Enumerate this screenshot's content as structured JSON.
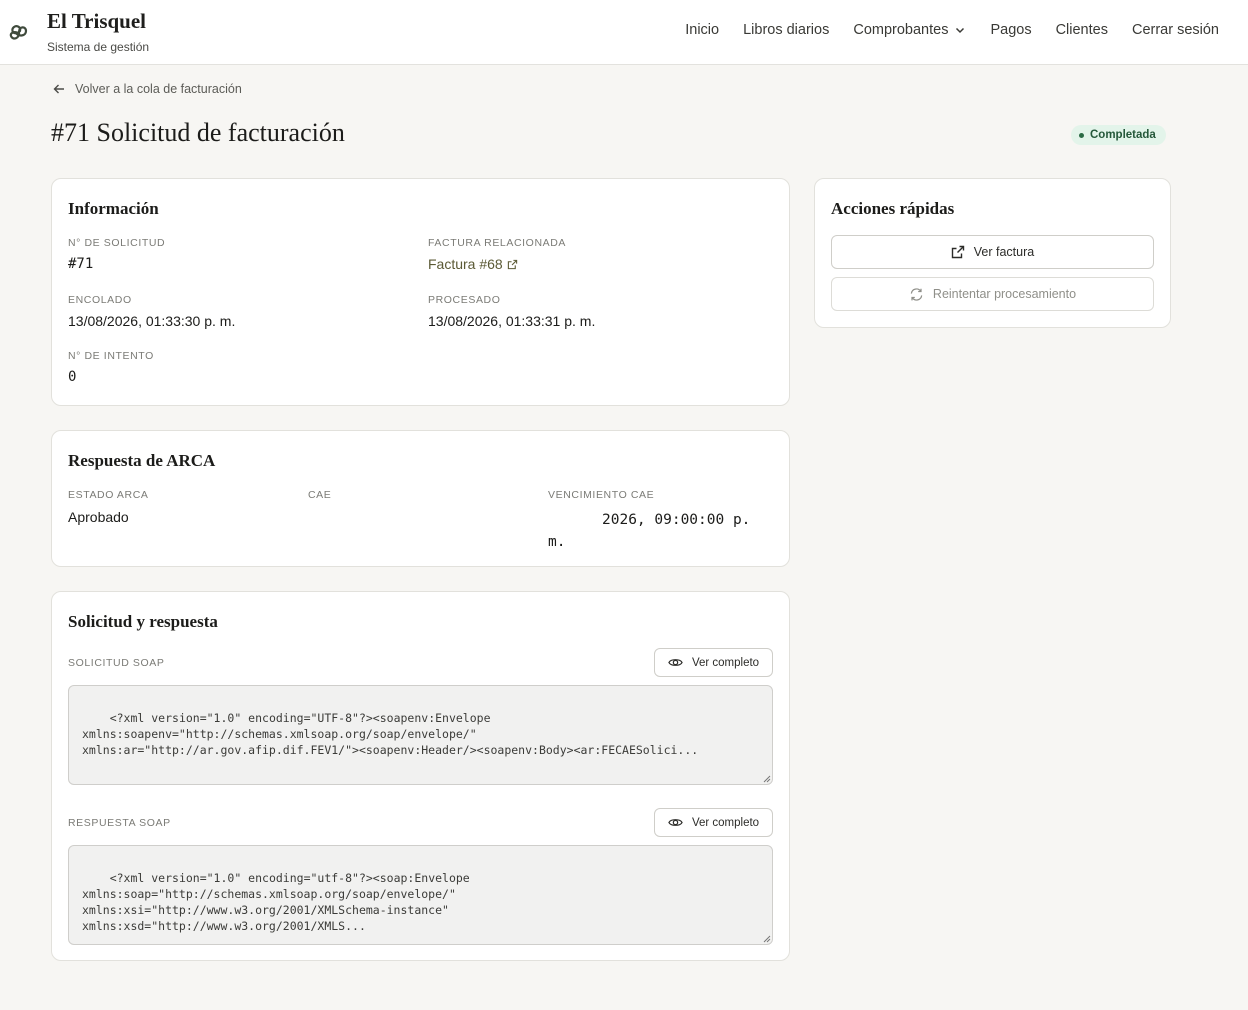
{
  "header": {
    "brand_title": "El Trisquel",
    "brand_subtitle": "Sistema de gestión",
    "nav": [
      "Inicio",
      "Libros diarios",
      "Comprobantes",
      "Pagos",
      "Clientes",
      "Cerrar sesión"
    ]
  },
  "back_link": "Volver a la cola de facturación",
  "page_title": "#71 Solicitud de facturación",
  "status_badge": "Completada",
  "info": {
    "title": "Información",
    "request_no_label": "N° DE SOLICITUD",
    "request_no": "#71",
    "related_invoice_label": "FACTURA RELACIONADA",
    "related_invoice": "Factura #68",
    "queued_label": "ENCOLADO",
    "queued": "13/08/2026, 01:33:30 p. m.",
    "processed_label": "PROCESADO",
    "processed": "13/08/2026, 01:33:31 p. m.",
    "attempt_label": "N° DE INTENTO",
    "attempt": "0"
  },
  "arca": {
    "title": "Respuesta de ARCA",
    "status_label": "ESTADO ARCA",
    "status": "Aprobado",
    "cae_label": "CAE",
    "cae": "",
    "expiry_label": "VENCIMIENTO CAE",
    "expiry": "2026, 09:00:00 p. m."
  },
  "soap": {
    "title": "Solicitud y respuesta",
    "request_label": "SOLICITUD SOAP",
    "request_button": "Ver completo",
    "request_text": "<?xml version=\"1.0\" encoding=\"UTF-8\"?><soapenv:Envelope\nxmlns:soapenv=\"http://schemas.xmlsoap.org/soap/envelope/\"\nxmlns:ar=\"http://ar.gov.afip.dif.FEV1/\"><soapenv:Header/><soapenv:Body><ar:FECAESolici...",
    "response_label": "RESPUESTA SOAP",
    "response_button": "Ver completo",
    "response_text": "<?xml version=\"1.0\" encoding=\"utf-8\"?><soap:Envelope\nxmlns:soap=\"http://schemas.xmlsoap.org/soap/envelope/\"\nxmlns:xsi=\"http://www.w3.org/2001/XMLSchema-instance\"\nxmlns:xsd=\"http://www.w3.org/2001/XMLS..."
  },
  "quick_actions": {
    "title": "Acciones rápidas",
    "view_invoice": "Ver factura",
    "retry": "Reintentar procesamiento"
  },
  "colors": {
    "background": "#f7f6f3",
    "badge_bg": "#e3f4ea",
    "badge_text": "#25583a",
    "link": "#5b5a35"
  }
}
